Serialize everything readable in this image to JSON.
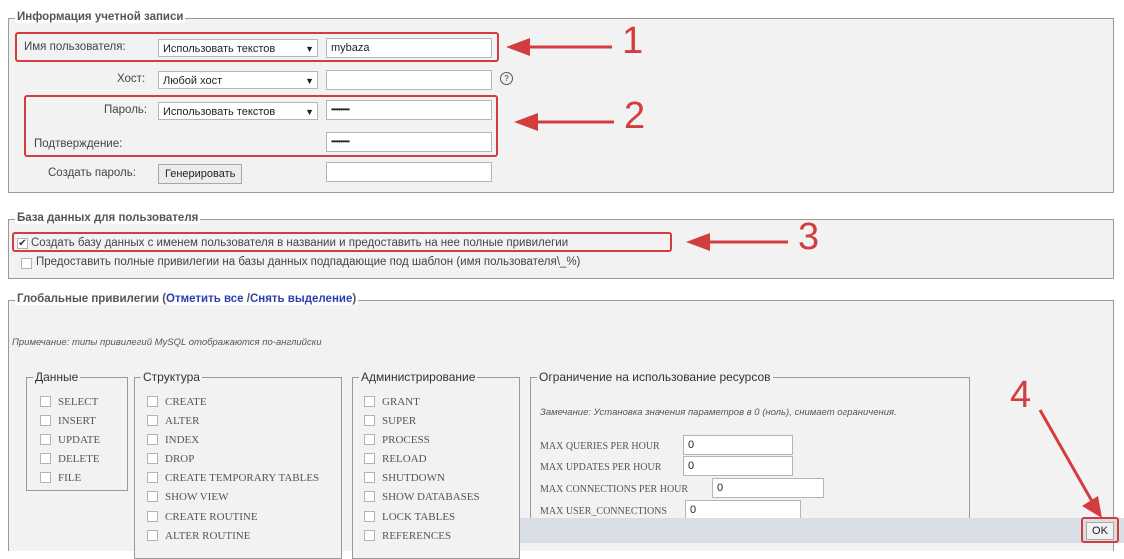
{
  "account": {
    "legend": "Информация учетной записи",
    "username_label": "Имя пользователя:",
    "username_mode": "Использовать текстов",
    "username_value": "mybaza",
    "host_label": "Хост:",
    "host_mode": "Любой хост",
    "host_value": "",
    "help_icon": "?",
    "password_label": "Пароль:",
    "password_mode": "Использовать текстов",
    "password_value": "••••••••••",
    "confirm_label": "Подтверждение:",
    "confirm_value": "••••••••••",
    "generate_label": "Создать пароль:",
    "generate_button": "Генерировать",
    "generate_value": ""
  },
  "database": {
    "legend": "База данных для пользователя",
    "option_create": "Создать базу данных с именем пользователя в названии и предоставить на нее полные привилегии",
    "option_create_checked": true,
    "option_wildcard": "Предоставить полные привилегии на базы данных подпадающие под шаблон (имя пользователя\\_%)",
    "option_wildcard_checked": false
  },
  "global": {
    "legend_prefix": "Глобальные привилегии (",
    "check_all": "Отметить все",
    "separator": " /",
    "uncheck_all": "Снять выделение",
    "legend_suffix": ")",
    "note": "Примечание: типы привилегий MySQL отображаются по-английски"
  },
  "groups": {
    "data": {
      "title": "Данные",
      "items": [
        "SELECT",
        "INSERT",
        "UPDATE",
        "DELETE",
        "FILE"
      ]
    },
    "structure": {
      "title": "Структура",
      "items": [
        "CREATE",
        "ALTER",
        "INDEX",
        "DROP",
        "CREATE TEMPORARY TABLES",
        "SHOW VIEW",
        "CREATE ROUTINE",
        "ALTER ROUTINE"
      ]
    },
    "admin": {
      "title": "Администрирование",
      "items": [
        "GRANT",
        "SUPER",
        "PROCESS",
        "RELOAD",
        "SHUTDOWN",
        "SHOW DATABASES",
        "LOCK TABLES",
        "REFERENCES"
      ]
    }
  },
  "limits": {
    "title": "Ограничение на использование ресурсов",
    "note": "Замечание: Установка значения параметров в 0 (ноль), снимает ограничения.",
    "rows": [
      {
        "label": "MAX QUERIES PER HOUR",
        "value": "0"
      },
      {
        "label": "MAX UPDATES PER HOUR",
        "value": "0"
      },
      {
        "label": "MAX CONNECTIONS PER HOUR",
        "value": "0"
      },
      {
        "label": "MAX USER_CONNECTIONS",
        "value": "0"
      }
    ]
  },
  "ok_button": "OK",
  "annotations": {
    "n1": "1",
    "n2": "2",
    "n3": "3",
    "n4": "4",
    "color": "#d33d3d"
  }
}
